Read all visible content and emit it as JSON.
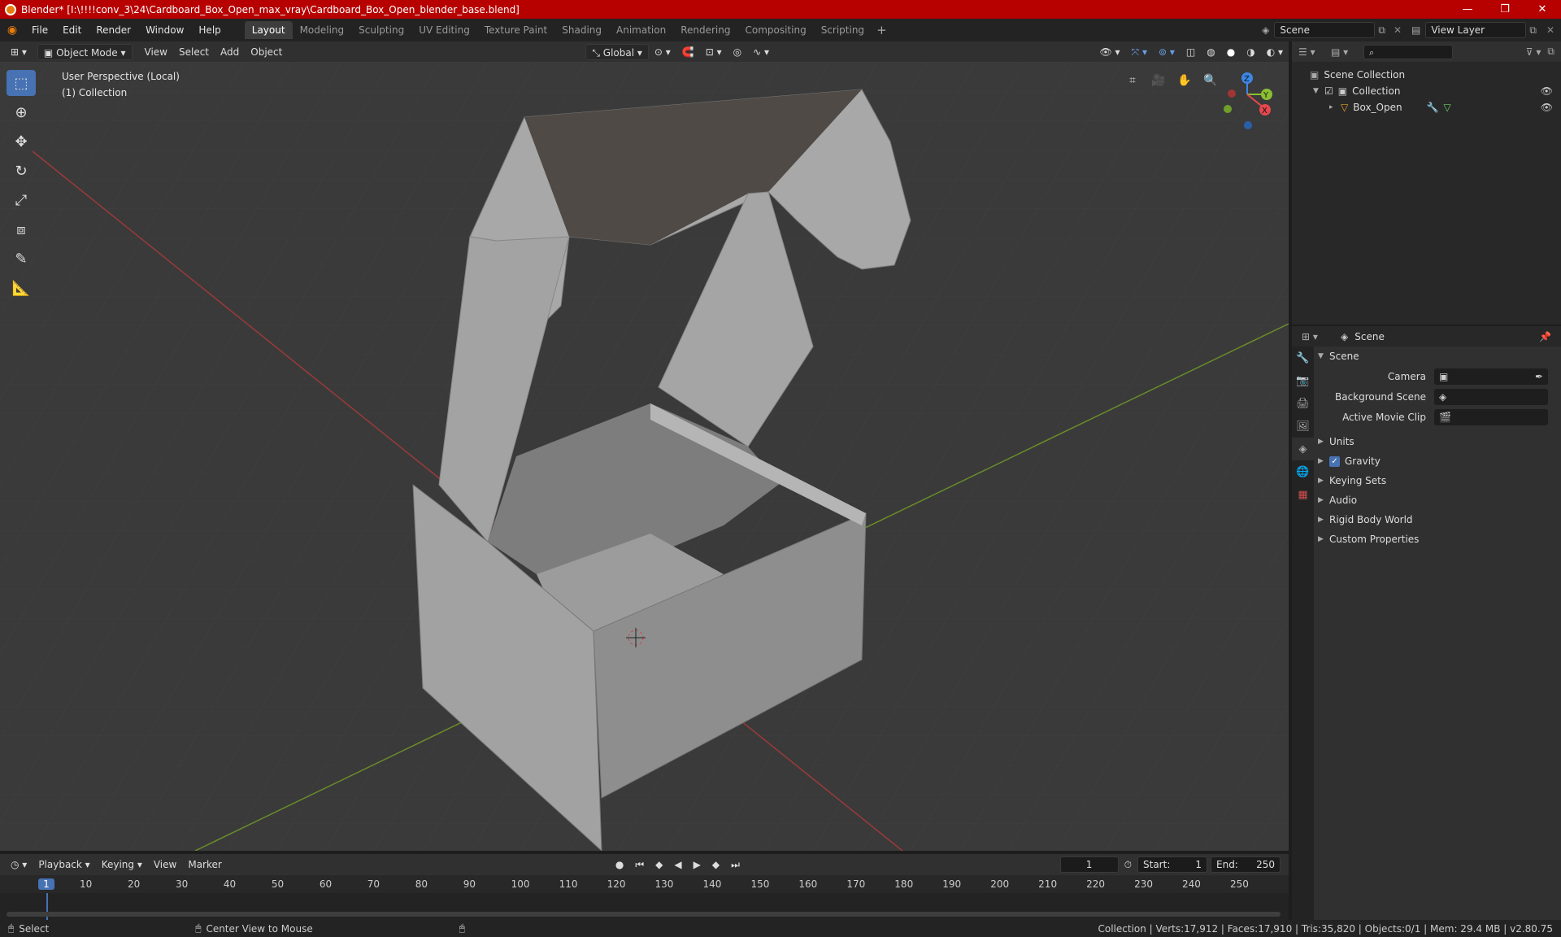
{
  "window": {
    "title": "Blender* [I:\\!!!!conv_3\\24\\Cardboard_Box_Open_max_vray\\Cardboard_Box_Open_blender_base.blend]"
  },
  "menu": [
    "File",
    "Edit",
    "Render",
    "Window",
    "Help"
  ],
  "workspaces": [
    "Layout",
    "Modeling",
    "Sculpting",
    "UV Editing",
    "Texture Paint",
    "Shading",
    "Animation",
    "Rendering",
    "Compositing",
    "Scripting"
  ],
  "topright": {
    "scene": "Scene",
    "view_layer": "View Layer"
  },
  "viewport_header": {
    "mode": "Object Mode",
    "menus": [
      "View",
      "Select",
      "Add",
      "Object"
    ],
    "orientation": "Global"
  },
  "viewport": {
    "perspective": "User Perspective (Local)",
    "collection": "(1) Collection"
  },
  "gizmo": {
    "x": "X",
    "y": "Y",
    "z": "Z"
  },
  "outliner": {
    "root": "Scene Collection",
    "collection": "Collection",
    "object": "Box_Open"
  },
  "properties": {
    "header": "Scene",
    "panel": "Scene",
    "fields": [
      {
        "label": "Camera"
      },
      {
        "label": "Background Scene"
      },
      {
        "label": "Active Movie Clip"
      }
    ],
    "sections": [
      "Units",
      "Gravity",
      "Keying Sets",
      "Audio",
      "Rigid Body World",
      "Custom Properties"
    ],
    "gravity_checked": true
  },
  "timeline": {
    "menus": [
      "Playback",
      "Keying",
      "View",
      "Marker"
    ],
    "current_frame": "1",
    "start_label": "Start:",
    "start": "1",
    "end_label": "End:",
    "end": "250",
    "ruler": [
      "1",
      "10",
      "20",
      "30",
      "40",
      "50",
      "60",
      "70",
      "80",
      "90",
      "100",
      "110",
      "120",
      "130",
      "140",
      "150",
      "160",
      "170",
      "180",
      "190",
      "200",
      "210",
      "220",
      "230",
      "240",
      "250"
    ]
  },
  "statusbar": {
    "select": "Select",
    "center": "Center View to Mouse",
    "stats": "Collection | Verts:17,912 | Faces:17,910 | Tris:35,820 | Objects:0/1 | Mem: 29.4 MB | v2.80.75"
  },
  "colors": {
    "accent": "#4772b3",
    "titlebar": "#b70000",
    "x_axis": "#e5484d",
    "y_axis": "#8bbf33",
    "z_axis": "#3d87e6"
  }
}
